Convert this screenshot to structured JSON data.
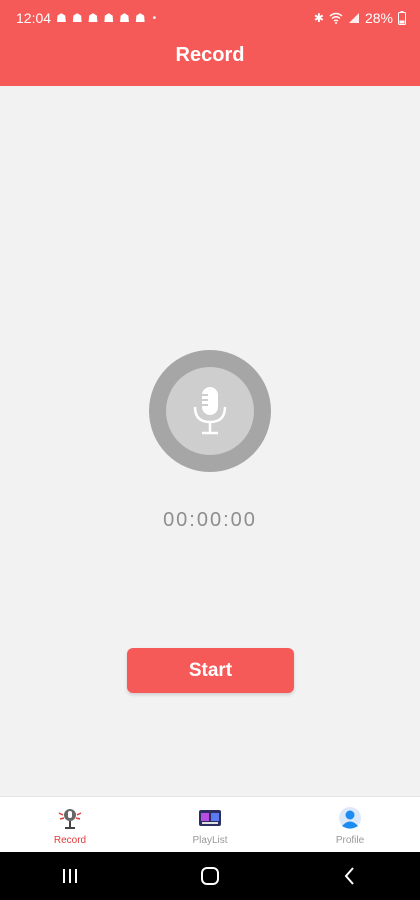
{
  "status_bar": {
    "time": "12:04",
    "notification_icons": [
      "snapchat-icon",
      "snapchat-icon",
      "snapchat-icon",
      "snapchat-icon",
      "snapchat-icon",
      "snapchat-icon"
    ],
    "battery": "28%"
  },
  "header": {
    "title": "Record"
  },
  "recorder": {
    "timer": "00:00:00",
    "start_label": "Start"
  },
  "bottom_nav": {
    "items": [
      {
        "label": "Record",
        "icon": "microphone-logo-icon",
        "active": true
      },
      {
        "label": "PlayList",
        "icon": "playlist-app-icon",
        "active": false
      },
      {
        "label": "Profile",
        "icon": "person-icon",
        "active": false
      }
    ]
  },
  "colors": {
    "accent": "#f65a58",
    "active_nav": "#e23b3b",
    "background": "#f2f2f2"
  }
}
